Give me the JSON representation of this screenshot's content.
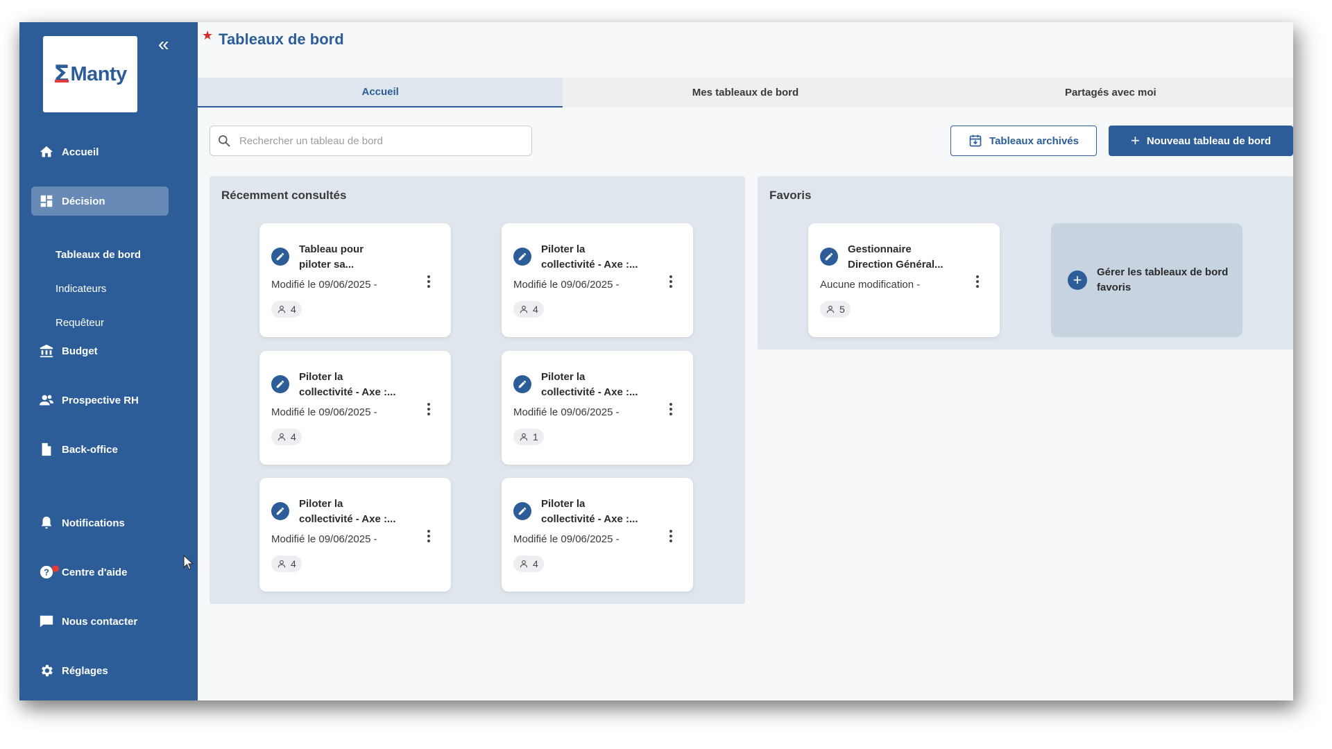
{
  "sidebar": {
    "logo_text": "Manty",
    "logo_symbol": "Σ",
    "collapse_label": "«",
    "items": [
      {
        "label": "Accueil",
        "icon": "home-icon"
      },
      {
        "label": "Décision",
        "icon": "dashboard-icon",
        "active": true
      },
      {
        "label": "Budget",
        "icon": "bank-icon"
      },
      {
        "label": "Prospective RH",
        "icon": "people-icon"
      },
      {
        "label": "Back-office",
        "icon": "document-icon"
      },
      {
        "label": "Notifications",
        "icon": "bell-icon"
      },
      {
        "label": "Centre d'aide",
        "icon": "help-icon"
      },
      {
        "label": "Nous contacter",
        "icon": "chat-icon"
      },
      {
        "label": "Réglages",
        "icon": "gear-icon"
      }
    ],
    "sub_items": [
      {
        "label": "Tableaux de bord",
        "active": true
      },
      {
        "label": "Indicateurs"
      },
      {
        "label": "Requêteur"
      }
    ]
  },
  "header": {
    "star": "★",
    "title": "Tableaux de bord"
  },
  "tabs": [
    {
      "label": "Accueil",
      "active": true
    },
    {
      "label": "Mes tableaux de bord"
    },
    {
      "label": "Partagés avec moi"
    }
  ],
  "search": {
    "placeholder": "Rechercher un tableau de bord",
    "value": ""
  },
  "actions": {
    "archived_label": "Tableaux archivés",
    "new_label": "Nouveau tableau de bord",
    "new_plus": "+"
  },
  "recent": {
    "title": "Récemment consultés",
    "cards": [
      {
        "title_1": "Tableau pour",
        "title_2": "piloter sa...",
        "modified": "Modifié le 09/06/2025  -",
        "users": "4"
      },
      {
        "title_1": "Piloter la",
        "title_2": "collectivité - Axe :...",
        "modified": "Modifié le 09/06/2025  -",
        "users": "4"
      },
      {
        "title_1": "Piloter la",
        "title_2": "collectivité - Axe :...",
        "modified": "Modifié le 09/06/2025  -",
        "users": "4"
      },
      {
        "title_1": "Piloter la",
        "title_2": "collectivité - Axe :...",
        "modified": "Modifié le 09/06/2025  -",
        "users": "1"
      },
      {
        "title_1": "Piloter la",
        "title_2": "collectivité - Axe :...",
        "modified": "Modifié le 09/06/2025  -",
        "users": "4"
      },
      {
        "title_1": "Piloter la",
        "title_2": "collectivité - Axe :...",
        "modified": "Modifié le 09/06/2025  -",
        "users": "4"
      }
    ]
  },
  "favorites": {
    "title": "Favoris",
    "cards": [
      {
        "title_1": "Gestionnaire",
        "title_2": "Direction Général...",
        "modified": "Aucune modification  -",
        "users": "5"
      }
    ],
    "manage_plus": "+",
    "manage_label": "Gérer les tableaux de bord favoris"
  },
  "colors": {
    "primary": "#2c5d99",
    "panel": "#dfe6ee",
    "accent_red": "#d62b2b"
  }
}
